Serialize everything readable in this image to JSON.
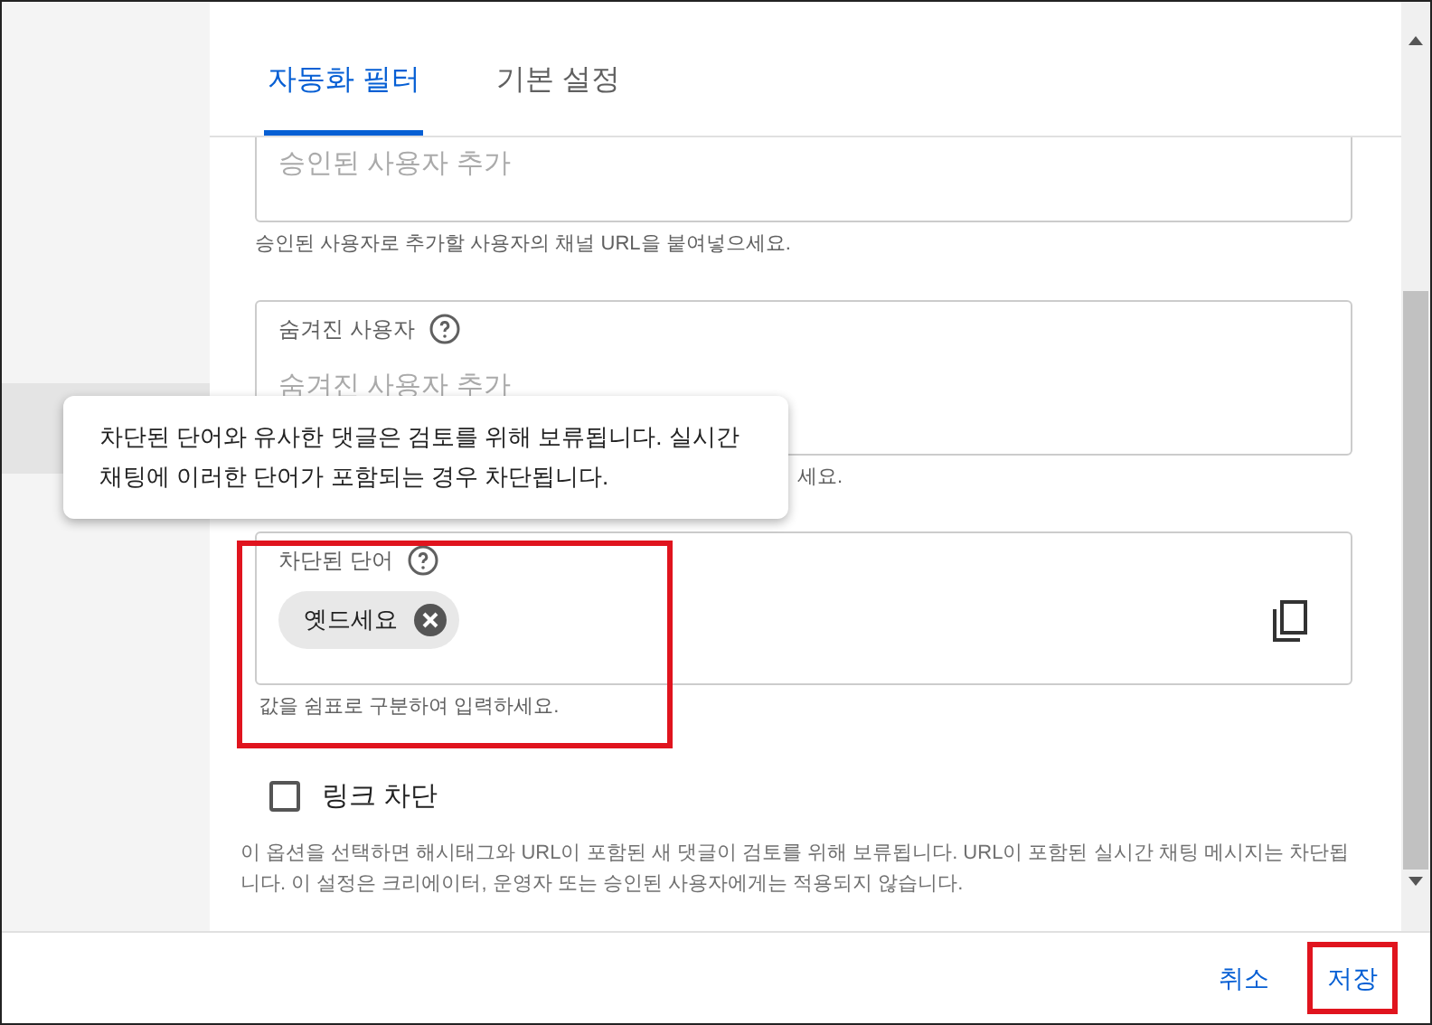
{
  "tabs": [
    {
      "label": "자동화 필터",
      "selected": true
    },
    {
      "label": "기본 설정",
      "selected": false
    }
  ],
  "approved_users": {
    "placeholder": "승인된 사용자 추가",
    "helper": "승인된 사용자로 추가할 사용자의 채널 URL을 붙여넣으세요."
  },
  "hidden_users": {
    "label": "숨겨진 사용자",
    "placeholder": "숨겨진 사용자 추가",
    "helper": "세요."
  },
  "tooltip": {
    "text": "차단된 단어와 유사한 댓글은 검토를 위해 보류됩니다. 실시간 채팅에 이러한 단어가 포함되는 경우 차단됩니다."
  },
  "blocked_words": {
    "label": "차단된 단어",
    "highlighted": true,
    "chips": [
      "옛드세요"
    ],
    "helper": "값을 쉼표로 구분하여 입력하세요."
  },
  "block_links": {
    "label": "링크 차단",
    "checked": false,
    "description": "이 옵션을 선택하면 해시태그와 URL이 포함된 새 댓글이 검토를 위해 보류됩니다. URL이 포함된 실시간 채팅 메시지는 차단됩니다. 이 설정은 크리에이터, 운영자 또는 승인된 사용자에게는 적용되지 않습니다."
  },
  "buttons": [
    {
      "label": "취소",
      "highlighted": false
    },
    {
      "label": "저장",
      "highlighted": true
    }
  ]
}
